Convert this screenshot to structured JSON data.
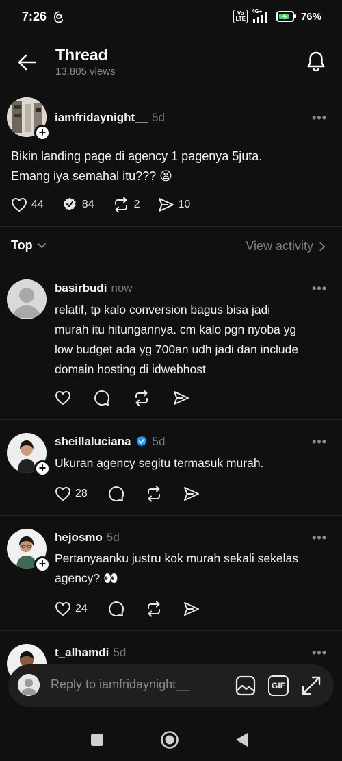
{
  "status_bar": {
    "time": "7:26",
    "volte_top": "Vo",
    "volte_bottom": "LTE",
    "network": "4G+",
    "battery": "76%"
  },
  "header": {
    "title": "Thread",
    "views": "13,805 views"
  },
  "op": {
    "username": "iamfridaynight__",
    "time": "5d",
    "text_line1": "Bikin landing page di agency 1 pagenya 5juta.",
    "text_line2": "Emang iya semahal itu??? 😫",
    "likes": "44",
    "comments": "84",
    "reposts": "2",
    "shares": "10"
  },
  "sort": {
    "label": "Top",
    "view_activity": "View activity"
  },
  "replies": [
    {
      "username": "basirbudi",
      "time": "now",
      "lines": [
        "relatif, tp kalo conversion bagus bisa jadi",
        "murah itu hitungannya. cm kalo pgn nyoba yg",
        "low budget ada yg 700an udh jadi dan include",
        "domain hosting di idwebhost"
      ],
      "likes": ""
    },
    {
      "username": "sheillaluciana",
      "time": "5d",
      "lines": [
        "Ukuran agency segitu termasuk murah."
      ],
      "likes": "28"
    },
    {
      "username": "hejosmo",
      "time": "5d",
      "lines": [
        "Pertanyaanku justru kok murah sekali sekelas",
        "agency? 👀"
      ],
      "likes": "24"
    },
    {
      "username": "t_alhamdi",
      "time": "5d",
      "lines": [],
      "likes": ""
    }
  ],
  "composer": {
    "placeholder": "Reply to iamfridaynight__",
    "gif_label": "GIF"
  },
  "colors": {
    "background": "#101010",
    "verified": "#1d9bf0",
    "muted": "#8a8a8a"
  }
}
